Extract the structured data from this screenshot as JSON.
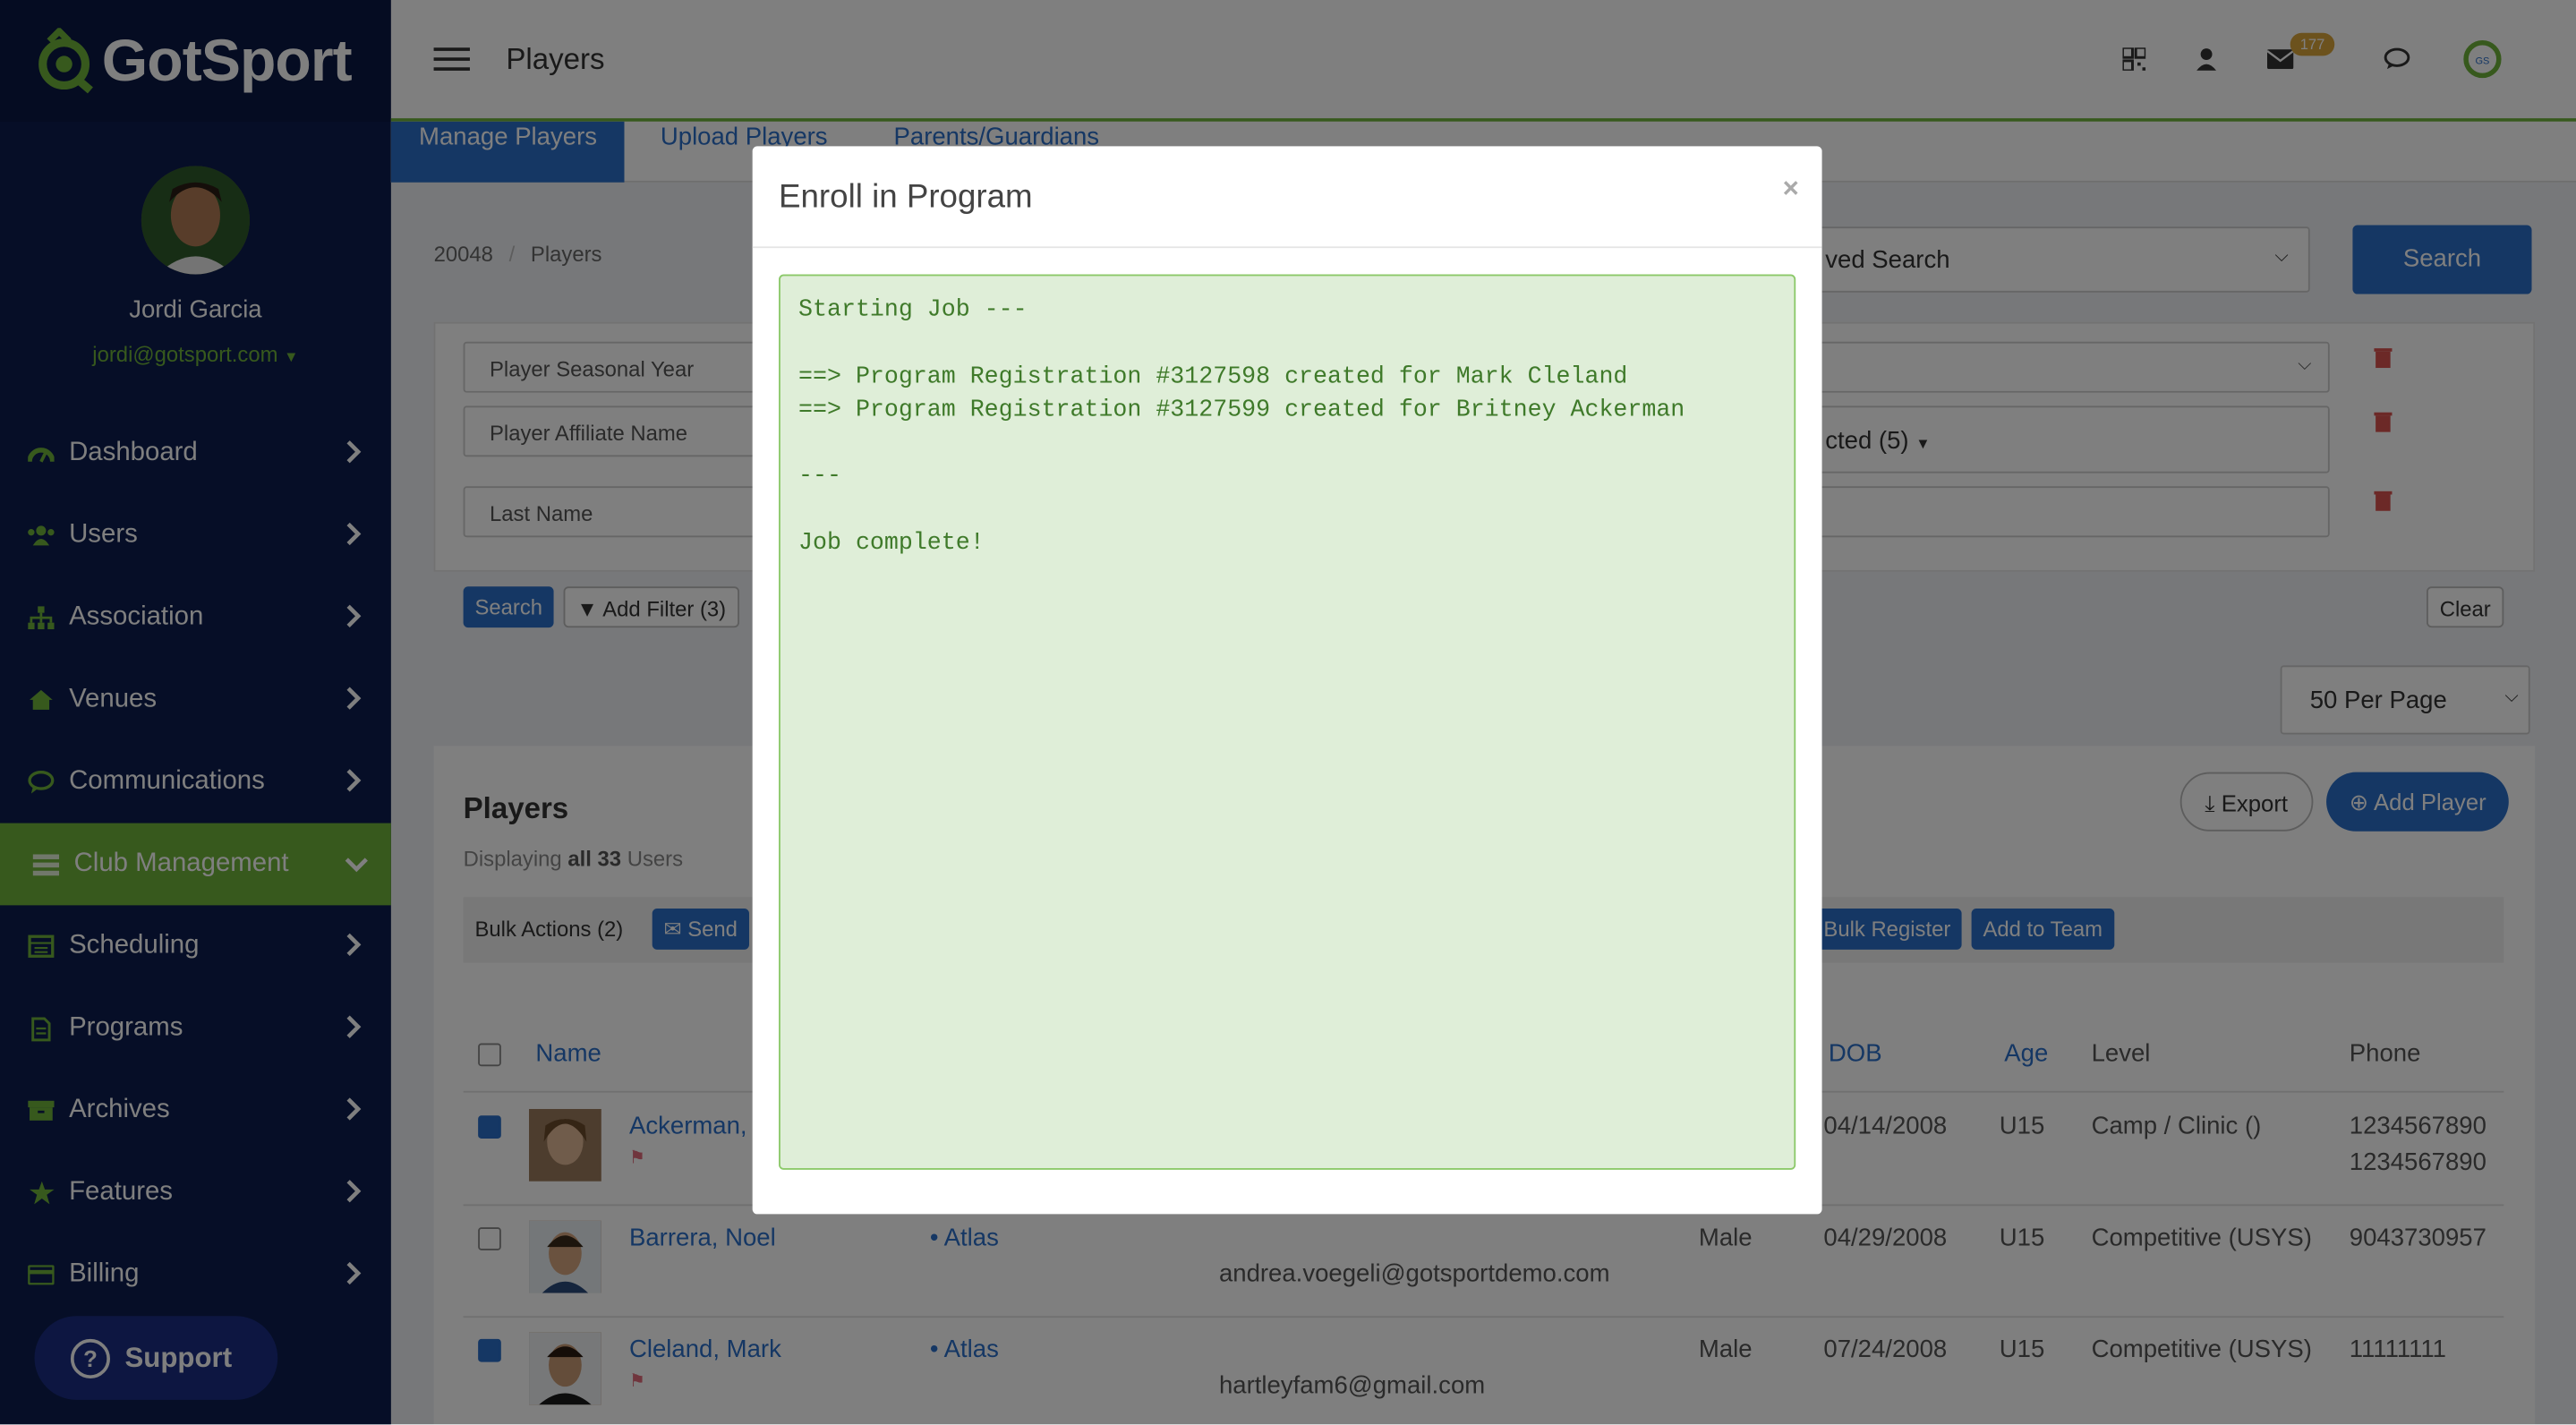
{
  "brand": {
    "logo_text": "GotSport"
  },
  "user": {
    "name": "Jordi Garcia",
    "email": "jordi@gotsport.com"
  },
  "nav": [
    {
      "label": "Dashboard",
      "icon": "dashboard-icon"
    },
    {
      "label": "Users",
      "icon": "users-icon"
    },
    {
      "label": "Association",
      "icon": "sitemap-icon"
    },
    {
      "label": "Venues",
      "icon": "home-icon"
    },
    {
      "label": "Communications",
      "icon": "chat-icon"
    },
    {
      "label": "Club Management",
      "icon": "club-icon",
      "active": true
    },
    {
      "label": "Scheduling",
      "icon": "calendar-icon"
    },
    {
      "label": "Programs",
      "icon": "document-icon"
    },
    {
      "label": "Archives",
      "icon": "archive-icon"
    },
    {
      "label": "Features",
      "icon": "star-icon"
    },
    {
      "label": "Billing",
      "icon": "credit-card-icon"
    }
  ],
  "support": {
    "label": "Support"
  },
  "header": {
    "title": "Players",
    "mail_count": "177"
  },
  "tabs": [
    "Manage Players",
    "Upload Players",
    "Parents/Guardians"
  ],
  "breadcrumb": {
    "id": "20048",
    "separator": "/",
    "page": "Players"
  },
  "search": {
    "saved_search_placeholder": "ved Search",
    "button": "Search"
  },
  "filters": {
    "field1": "Player Seasonal Year",
    "field2": "Player Affiliate Name",
    "field3": "Last Name",
    "selected": "cted (5)",
    "search_btn": "Search",
    "add_filter_btn": "Add Filter (3)",
    "clear_btn": "Clear"
  },
  "per_page": "50 Per Page",
  "players_panel": {
    "title": "Players",
    "displaying_prefix": "Displaying",
    "displaying_bold": "all 33",
    "displaying_suffix": "Users",
    "export": "Export",
    "add_player": "Add Player",
    "bulk_actions": "Bulk Actions (2)",
    "send": "Send",
    "bulk_register": "Bulk Register",
    "add_to_team": "Add to Team"
  },
  "table": {
    "headers": {
      "name": "Name",
      "dob": "DOB",
      "age": "Age",
      "level": "Level",
      "phone": "Phone"
    },
    "rows": [
      {
        "name": "Ackerman,",
        "club": "",
        "email": "",
        "gender": "",
        "dob": "04/14/2008",
        "age": "U15",
        "level": "Camp / Clinic ()",
        "phone": "1234567890",
        "phone2": "1234567890",
        "checked": true,
        "flag": true
      },
      {
        "name": "Barrera, Noel",
        "club": "Atlas",
        "email": "andrea.voegeli@gotsportdemo.com",
        "gender": "Male",
        "dob": "04/29/2008",
        "age": "U15",
        "level": "Competitive (USYS)",
        "phone": "9043730957",
        "phone2": "",
        "checked": false,
        "flag": false
      },
      {
        "name": "Cleland, Mark",
        "club": "Atlas",
        "email": "hartleyfam6@gmail.com",
        "gender": "Male",
        "dob": "07/24/2008",
        "age": "U15",
        "level": "Competitive (USYS)",
        "phone": "11111111",
        "phone2": "",
        "checked": true,
        "flag": true
      }
    ]
  },
  "modal": {
    "title": "Enroll in Program",
    "close": "×",
    "log": "Starting Job ---\n\n==> Program Registration #3127598 created for Mark Cleland\n==> Program Registration #3127599 created for Britney Ackerman\n\n---\n\nJob complete!"
  }
}
